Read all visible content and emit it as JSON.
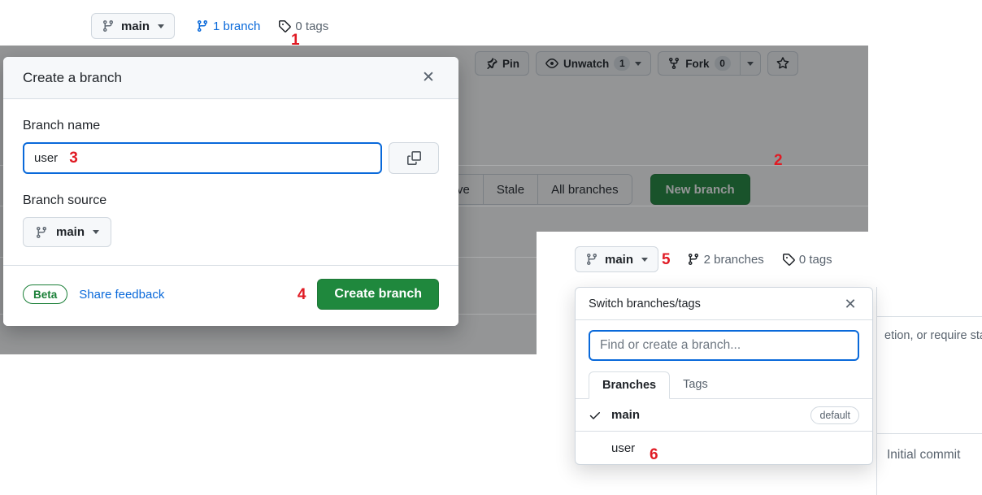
{
  "top_screenshot": {
    "branch_bar": {
      "current_branch": "main",
      "branch_count_label": "1 branch",
      "tag_count_label": "0 tags",
      "branch_icon": "git-branch-icon",
      "tag_icon": "tag-icon"
    },
    "repo_toolbar": {
      "pin_label": "Pin",
      "unwatch_label": "Unwatch",
      "unwatch_count": "1",
      "fork_label": "Fork",
      "fork_count": "0",
      "star_icon": "star-icon",
      "pin_icon": "pin-icon",
      "eye_icon": "eye-icon",
      "fork_icon": "repo-forked-icon"
    },
    "branch_filters": {
      "tabs": [
        "Active",
        "Stale",
        "All branches"
      ],
      "new_branch_label": "New branch"
    }
  },
  "modal": {
    "title": "Create a branch",
    "close_icon": "close-icon",
    "branch_name_label": "Branch name",
    "branch_name_value": "user",
    "copy_icon": "copy-icon",
    "branch_source_label": "Branch source",
    "branch_source_value": "main",
    "beta_badge": "Beta",
    "feedback_link": "Share feedback",
    "create_button": "Create branch"
  },
  "bottom_screenshot": {
    "branch_bar": {
      "current_branch": "main",
      "branch_count_label": "2 branches",
      "tag_count_label": "0 tags"
    },
    "popover": {
      "title": "Switch branches/tags",
      "close_icon": "close-icon",
      "search_placeholder": "Find or create a branch...",
      "search_value": "",
      "tabs": [
        {
          "label": "Branches",
          "active": true
        },
        {
          "label": "Tags",
          "active": false
        }
      ],
      "items": [
        {
          "name": "main",
          "selected": true,
          "badge": "default"
        },
        {
          "name": "user",
          "selected": false,
          "badge": ""
        }
      ]
    },
    "side_text": "etion, or require sta",
    "commit_text": "Initial commit"
  },
  "annotations": {
    "step1": "1",
    "step2": "2",
    "step3": "3",
    "step4": "4",
    "step5": "5",
    "step6": "6",
    "color": "#e01b24"
  }
}
